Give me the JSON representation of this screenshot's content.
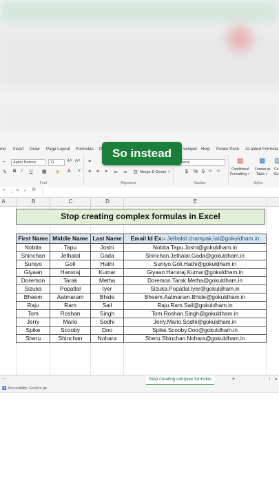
{
  "overlay": {
    "label": "So instead"
  },
  "ribbon": {
    "tabs": [
      "me",
      "Insert",
      "Draw",
      "Page Layout",
      "Formulas",
      "D",
      "veloper",
      "Help",
      "Power Pivot",
      "AI-aided Formula"
    ],
    "font_name": "Aptos Narrow",
    "font_size": "11",
    "font_grow": "A˄",
    "font_shrink": "A˅",
    "bold": "B",
    "italic": "I",
    "underline": "U",
    "merge_center": "Merge & Center",
    "number_format": "eneral",
    "currency": "$",
    "percent": "%",
    "comma": "9",
    "conditional_formatting": [
      "Conditional",
      "Formatting ˅"
    ],
    "format_as_table": [
      "Format as",
      "Table ˅"
    ],
    "cell_styles": [
      "Ce",
      "Sty"
    ],
    "group_font": "Font",
    "group_alignment": "Alignment",
    "group_number": "Number",
    "group_styles": "Styles"
  },
  "formula_bar": {
    "fx": "fx"
  },
  "columns": [
    "A",
    "B",
    "C",
    "D",
    "E"
  ],
  "sheet": {
    "title": "Stop creating complex formulas in Excel",
    "headers": [
      "First Name",
      "Middle Name",
      "Last Name"
    ],
    "email_header_prefix": "Email Id Ex:- ",
    "email_header_example": "Jethalal.champak.lal@gokuldham.in",
    "rows": [
      [
        "Nobita",
        "Tapu",
        "Joshi",
        "Nobita.Tapu.Joshi@gokuldham.in"
      ],
      [
        "Shinchan",
        "Jethalal",
        "Gada",
        "Shinchan.Jethalal.Gada@gokuldham.in"
      ],
      [
        "Suniyo",
        "Goli",
        "Hathi",
        "Suniyo.Goli.Hathi@gokuldham.in"
      ],
      [
        "Giyaan",
        "Hansraj",
        "Kumar",
        "Giyaan.Hansraj.Kumar@gokuldham.in"
      ],
      [
        "Doremon",
        "Tarak",
        "Metha",
        "Doremon.Tarak.Metha@gokuldham.in"
      ],
      [
        "Sizuka",
        "Popatlal",
        "Iyer",
        "Sizuka.Popatlal.Iyer@gokuldham.in"
      ],
      [
        "Bheem",
        "Aatmaram",
        "Bhide",
        "Bheem.Aatmaram.Bhide@gokuldham.in"
      ],
      [
        "Raju",
        "Ram",
        "Sail",
        "Raju.Ram.Sail@gokuldham.in"
      ],
      [
        "Tom",
        "Roshan",
        "Singh",
        "Tom.Roshan.Singh@gokuldham.in"
      ],
      [
        "Jerry",
        "Mario",
        "Sodhi",
        "Jerry.Mario.Sodhi@gokuldham.in"
      ],
      [
        "Spike",
        "Scooby",
        "Doo",
        "Spike.Scooby.Doo@gokuldham.in"
      ],
      [
        "Sheru",
        "Shinchan",
        "Nohara",
        "Sheru.Shinchan.Nohara@gokuldham.in"
      ]
    ]
  },
  "sheet_tabs": {
    "active": "Stop creating complex formulas",
    "add": "+"
  },
  "status": {
    "accessibility": "Accessibility: Good to go"
  },
  "colors": {
    "accent": "#1a7f3b",
    "title_fill": "#e2f0d9",
    "header_fill": "#dbe6f1",
    "email_example": "#1f4e79"
  }
}
